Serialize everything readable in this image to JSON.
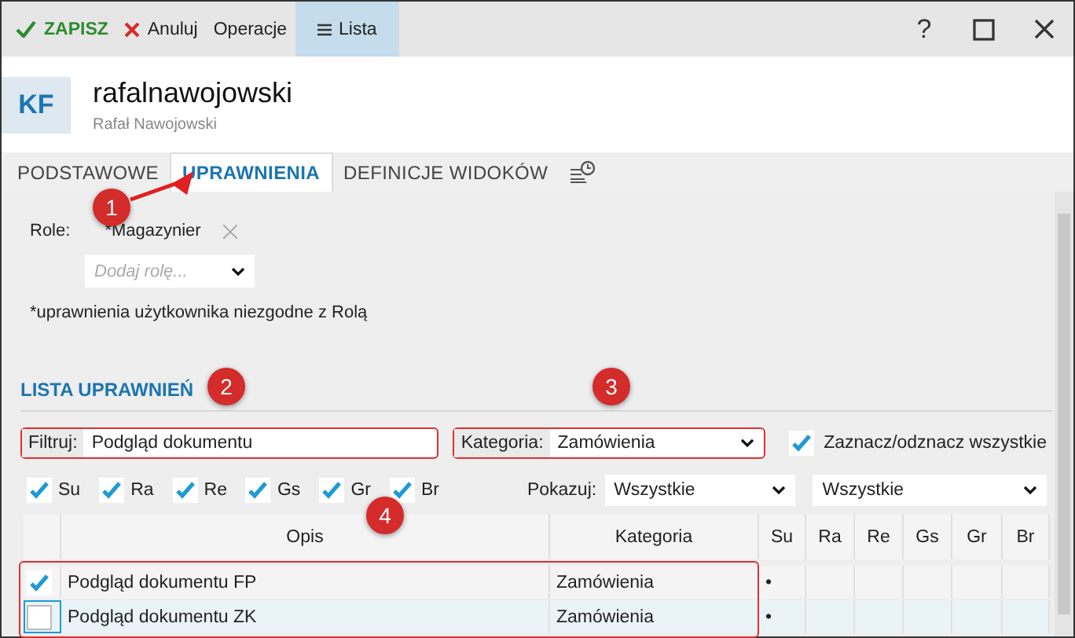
{
  "toolbar": {
    "buttons": [
      {
        "kind": "save",
        "label": "ZAPISZ",
        "selected": false
      },
      {
        "kind": "cancel",
        "label": "Anuluj",
        "selected": false
      },
      {
        "kind": "plain",
        "label": "Operacje",
        "selected": false
      },
      {
        "kind": "list",
        "label": "Lista",
        "selected": true
      }
    ],
    "window_controls": [
      {
        "kind": "help",
        "label": "?"
      },
      {
        "kind": "maximize"
      },
      {
        "kind": "close"
      }
    ]
  },
  "header": {
    "initials": "KF",
    "title": "rafalnawojowski",
    "subtitle": "Rafał Nawojowski"
  },
  "tabs": [
    {
      "kind": "text",
      "label": "PODSTAWOWE",
      "selected": false
    },
    {
      "kind": "text",
      "label": "UPRAWNIENIA",
      "selected": true
    },
    {
      "kind": "text",
      "label": "DEFINICJE WIDOKÓW",
      "selected": false
    },
    {
      "kind": "history",
      "selected": false
    }
  ],
  "roles": {
    "label": "Role:",
    "items": [
      "*Magazynier"
    ],
    "add_placeholder": "Dodaj rolę...",
    "note": "*uprawnienia użytkownika niezgodne z Rolą"
  },
  "permissions": {
    "title": "LISTA UPRAWNIEŃ",
    "filter": {
      "label": "Filtruj:",
      "value": "Podgląd dokumentu",
      "highlighted": true
    },
    "category": {
      "label": "Kategoria:",
      "value": "Zamówienia",
      "highlighted": true
    },
    "select_all": {
      "label": "Zaznacz/odznacz wszystkie",
      "checked": true
    },
    "flags": [
      {
        "label": "Su",
        "checked": true
      },
      {
        "label": "Ra",
        "checked": true
      },
      {
        "label": "Re",
        "checked": true
      },
      {
        "label": "Gs",
        "checked": true
      },
      {
        "label": "Gr",
        "checked": true
      },
      {
        "label": "Br",
        "checked": true
      }
    ],
    "show_label": "Pokazuj:",
    "show_values": [
      "Wszystkie",
      "Wszystkie"
    ],
    "table": {
      "columns": [
        "Opis",
        "Kategoria",
        "Su",
        "Ra",
        "Re",
        "Gs",
        "Gr",
        "Br"
      ],
      "rows_highlighted": true,
      "rows": [
        {
          "checked": true,
          "focused": false,
          "cells": [
            "Podgląd dokumentu FP",
            "Zamówienia",
            "•",
            "",
            "",
            "",
            "",
            ""
          ]
        },
        {
          "checked": false,
          "focused": true,
          "cells": [
            "Podgląd dokumentu ZK",
            "Zamówienia",
            "•",
            "",
            "",
            "",
            "",
            ""
          ]
        }
      ]
    }
  },
  "callouts": [
    {
      "label": "1"
    },
    {
      "label": "2"
    },
    {
      "label": "3"
    },
    {
      "label": "4"
    }
  ]
}
